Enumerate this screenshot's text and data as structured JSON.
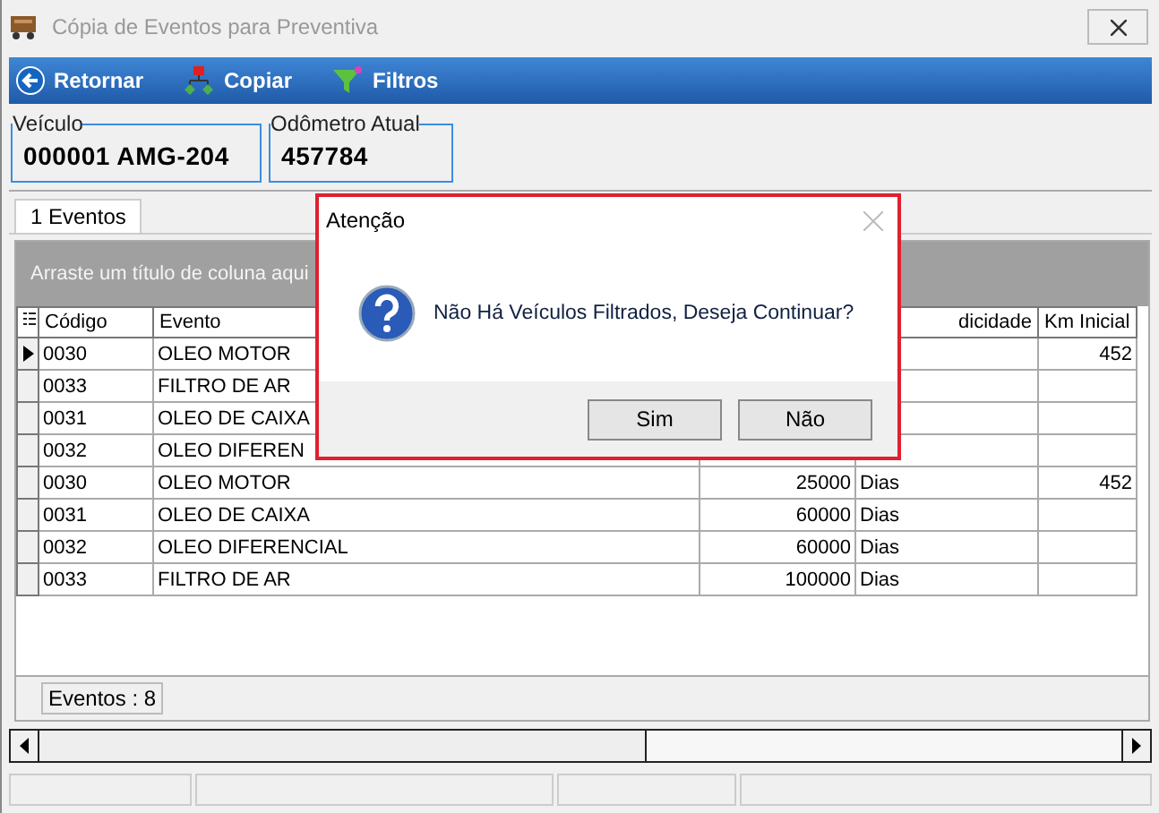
{
  "window": {
    "title": "Cópia de Eventos para Preventiva"
  },
  "toolbar": [
    {
      "kind": "back",
      "label": "Retornar"
    },
    {
      "kind": "copy",
      "label": "Copiar"
    },
    {
      "kind": "filter",
      "label": "Filtros"
    }
  ],
  "fields": [
    {
      "label": "Veículo",
      "value": "000001 AMG-204"
    },
    {
      "label": "Odômetro Atual",
      "value": "457784"
    }
  ],
  "tabs": [
    {
      "label": "1 Eventos",
      "selected": true
    }
  ],
  "grid": {
    "group_hint": "Arraste um título de coluna aqui",
    "columns": [
      "Código",
      "Evento",
      null,
      "dicidade",
      "Km Inicial"
    ],
    "rows": [
      {
        "selected": true,
        "cells": [
          "0030",
          "OLEO MOTOR",
          null,
          null,
          "452"
        ]
      },
      {
        "selected": false,
        "cells": [
          "0033",
          "FILTRO DE AR",
          null,
          null,
          null
        ]
      },
      {
        "selected": false,
        "cells": [
          "0031",
          "OLEO DE CAIXA",
          null,
          null,
          null
        ]
      },
      {
        "selected": false,
        "cells": [
          "0032",
          "OLEO DIFEREN",
          null,
          null,
          null
        ]
      },
      {
        "selected": false,
        "cells": [
          "0030",
          "OLEO MOTOR",
          "25000",
          "Dias",
          "452"
        ]
      },
      {
        "selected": false,
        "cells": [
          "0031",
          "OLEO DE CAIXA",
          "60000",
          "Dias",
          null
        ]
      },
      {
        "selected": false,
        "cells": [
          "0032",
          "OLEO DIFERENCIAL",
          "60000",
          "Dias",
          null
        ]
      },
      {
        "selected": false,
        "cells": [
          "0033",
          "FILTRO DE AR",
          "100000",
          "Dias",
          null
        ]
      }
    ],
    "footer": "Eventos : 8"
  },
  "dialog": {
    "title": "Atenção",
    "message": "Não Há Veículos Filtrados, Deseja Continuar?",
    "buttons": [
      "Sim",
      "Não"
    ]
  }
}
